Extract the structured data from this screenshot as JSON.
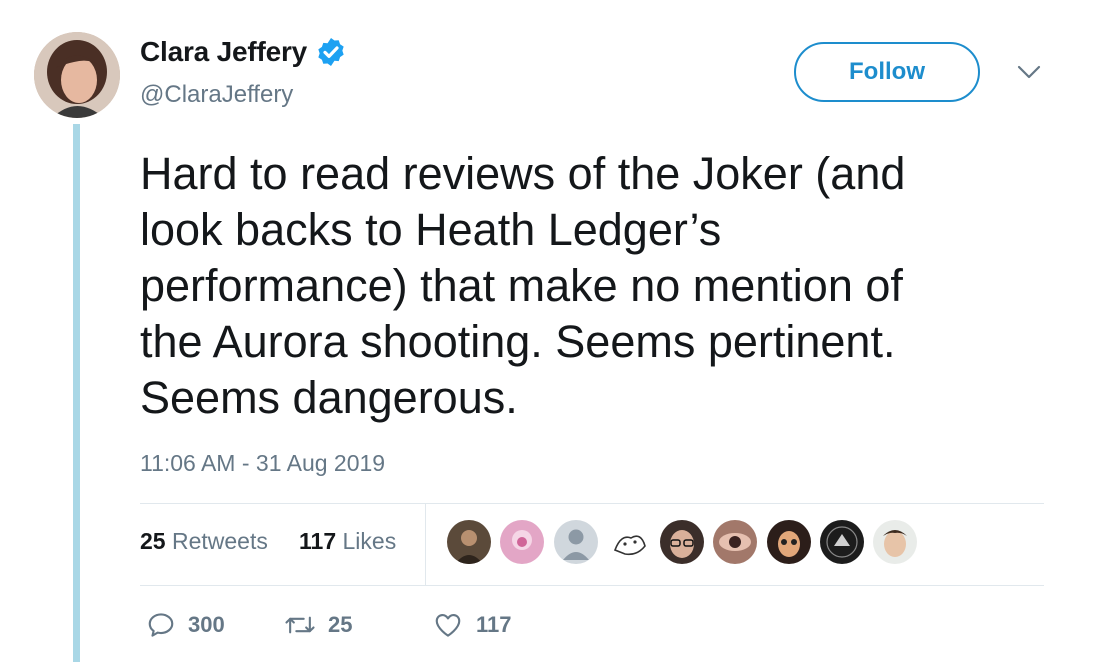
{
  "author": {
    "display_name": "Clara Jeffery",
    "handle": "@ClaraJeffery",
    "verified": true
  },
  "follow_label": "Follow",
  "tweet": {
    "text": "Hard to read reviews of the Joker (and\nlook backs to Heath Ledger’s\nperformance)  that make no mention of\nthe Aurora shooting. Seems pertinent.\nSeems dangerous.",
    "timestamp": "11:06 AM - 31 Aug 2019"
  },
  "stats": {
    "retweets_count": "25",
    "retweets_label": "Retweets",
    "likes_count": "117",
    "likes_label": "Likes"
  },
  "actions": {
    "reply_count": "300",
    "retweet_count": "25",
    "like_count": "117"
  },
  "colors": {
    "accent": "#1d8dcd",
    "thread_line": "#a9d7e6",
    "secondary_text": "#657786"
  },
  "likers": [
    "liker-1",
    "liker-2",
    "liker-3",
    "liker-4",
    "liker-5",
    "liker-6",
    "liker-7",
    "liker-8",
    "liker-9"
  ]
}
